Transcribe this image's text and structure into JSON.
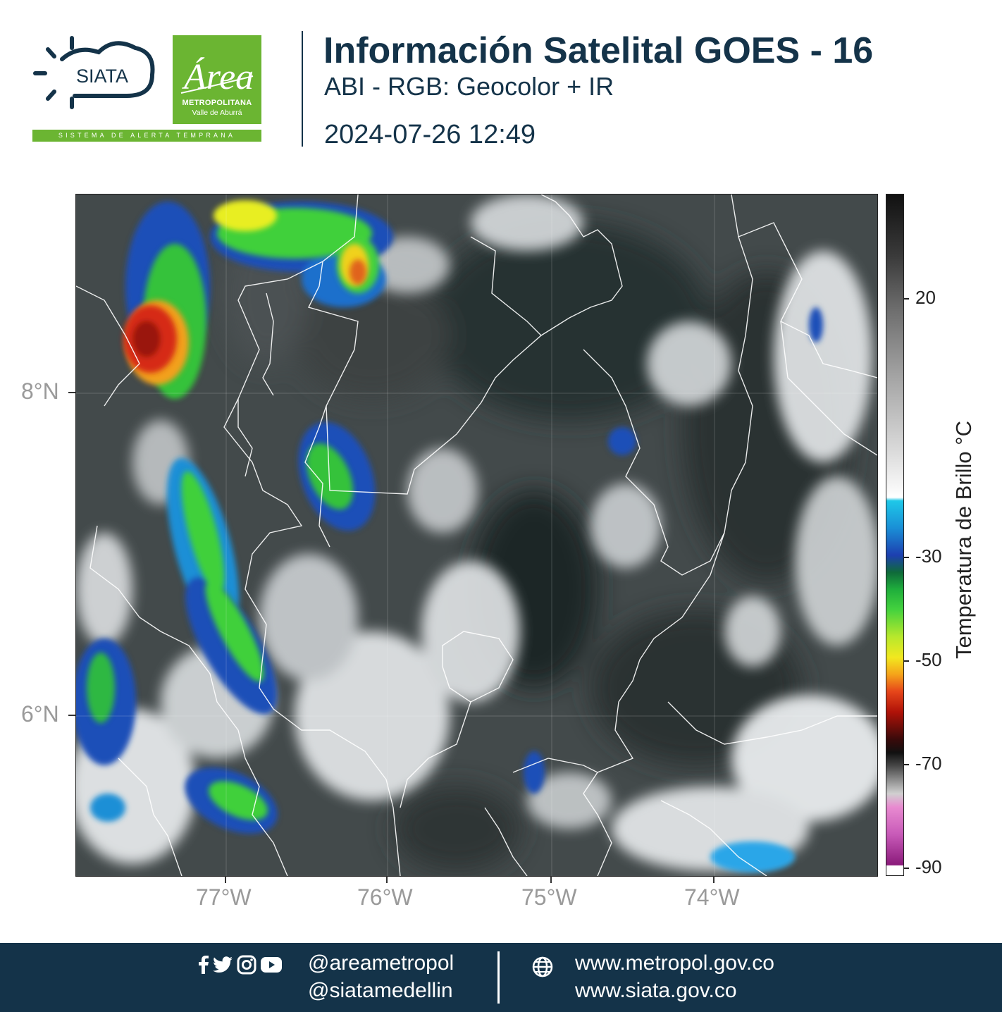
{
  "header": {
    "logo_siata": "SIATA",
    "siata_tagline": "SISTEMA DE ALERTA TEMPRANA",
    "logo_area_script": "Área",
    "logo_area_line1": "METROPOLITANA",
    "logo_area_line2": "Valle de Aburrá",
    "title": "Información Satelital GOES - 16",
    "subtitle": "ABI - RGB: Geocolor + IR",
    "timestamp": "2024-07-26 12:49"
  },
  "map": {
    "lon_labels": [
      "77°W",
      "76°W",
      "75°W",
      "74°W"
    ],
    "lat_labels": [
      "8°N",
      "6°N"
    ],
    "colors": {
      "cloud_white": "#eef1f3",
      "land_dark": "#2d3434",
      "green": "#3ec832",
      "yellow": "#e6ee22",
      "red": "#d62a12",
      "blue": "#1f58c6",
      "cyan": "#19b4e6",
      "borders": "#ffffff"
    }
  },
  "colorbar": {
    "title": "Temperatura de Brillo °C",
    "ticks": [
      "20",
      "-30",
      "-50",
      "-70",
      "-90"
    ]
  },
  "footer": {
    "handle1": "@areametropol",
    "handle2": "@siatamedellin",
    "site1": "www.metropol.gov.co",
    "site2": "www.siata.gov.co"
  }
}
